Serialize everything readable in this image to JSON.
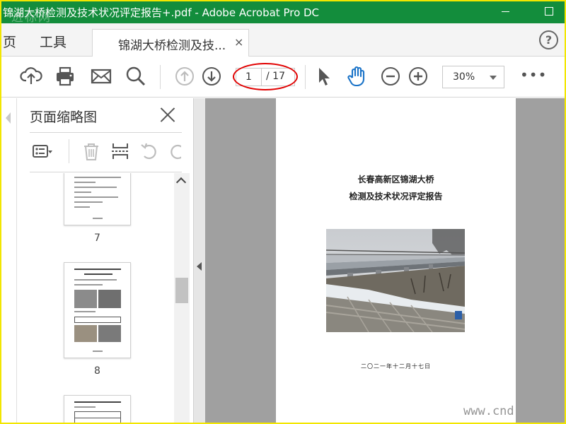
{
  "window": {
    "title": "锦湖大桥检测及技术状况评定报告+.pdf - Adobe Acrobat Pro DC",
    "watermark": "进标网"
  },
  "tabs": {
    "home": "页",
    "tools": "工具",
    "document": "锦湖大桥检测及技...",
    "close_glyph": "×",
    "help_glyph": "?"
  },
  "toolbar": {
    "icons": [
      "upload-icon",
      "print-icon",
      "email-icon",
      "search-icon",
      "page-up-icon",
      "page-down-icon",
      "select-cursor-icon",
      "hand-tool-icon",
      "zoom-out-icon",
      "zoom-in-icon",
      "more-icon"
    ],
    "current_page": "1",
    "total_pages": "/ 17",
    "zoom": "30%",
    "more_glyph": "•••",
    "annotation_color": "#e10000",
    "accent_color": "#1a73c8"
  },
  "panel": {
    "title": "页面缩略图",
    "tools": [
      "options-icon",
      "delete-icon",
      "extract-icon",
      "rotate-left-icon",
      "rotate-right-icon"
    ],
    "thumbnails": [
      {
        "label": "7"
      },
      {
        "label": "8"
      },
      {
        "label": ""
      }
    ]
  },
  "document": {
    "title_line1": "长春高新区锦湖大桥",
    "title_line2": "检测及技术状况评定报告",
    "photo": "bridge-photo",
    "date": "二〇二一年十二月十七日"
  },
  "footer_watermark": "www.cnd",
  "colors": {
    "titlebar": "#138d3c",
    "frame_border": "#f2e600",
    "canvas_gray": "#a0a0a0"
  }
}
